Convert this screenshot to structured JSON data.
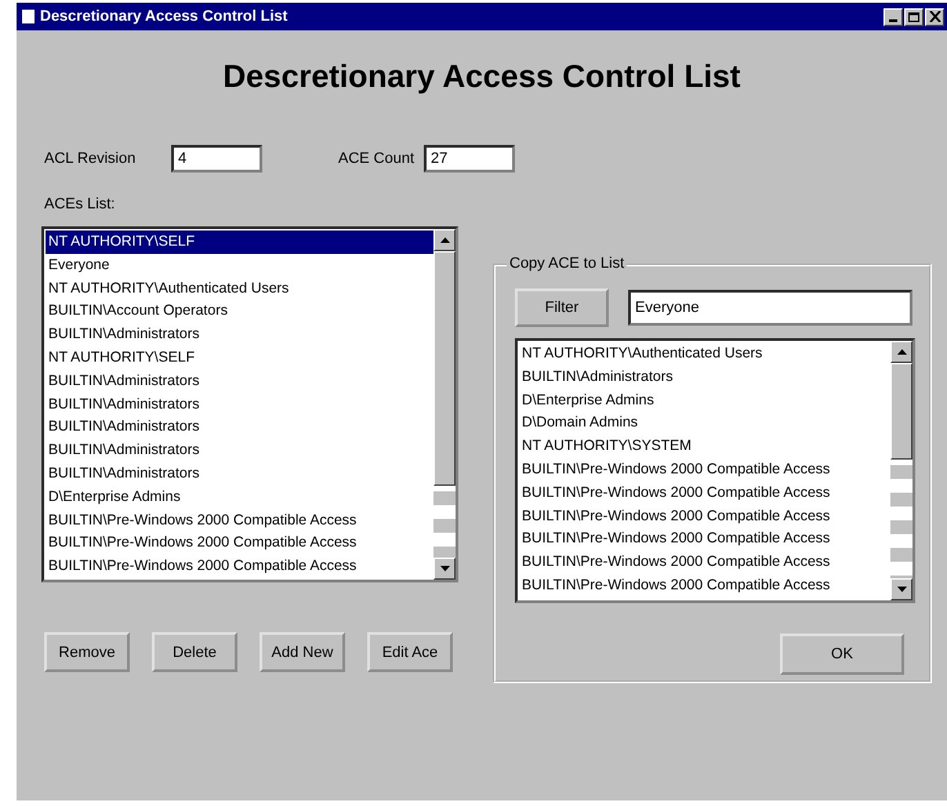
{
  "window": {
    "title": "Descretionary Access Control List"
  },
  "heading": "Descretionary Access Control List",
  "acl_revision": {
    "label": "ACL Revision",
    "value": "4"
  },
  "ace_count": {
    "label": "ACE Count",
    "value": "27"
  },
  "aces_list": {
    "label": "ACEs List:",
    "items": [
      {
        "text": "NT AUTHORITY\\SELF",
        "selected": true
      },
      {
        "text": "Everyone",
        "selected": false
      },
      {
        "text": "NT AUTHORITY\\Authenticated Users",
        "selected": false
      },
      {
        "text": "BUILTIN\\Account Operators",
        "selected": false
      },
      {
        "text": "BUILTIN\\Administrators",
        "selected": false
      },
      {
        "text": "NT AUTHORITY\\SELF",
        "selected": false
      },
      {
        "text": "BUILTIN\\Administrators",
        "selected": false
      },
      {
        "text": "BUILTIN\\Administrators",
        "selected": false
      },
      {
        "text": "BUILTIN\\Administrators",
        "selected": false
      },
      {
        "text": "BUILTIN\\Administrators",
        "selected": false
      },
      {
        "text": "BUILTIN\\Administrators",
        "selected": false
      },
      {
        "text": "D\\Enterprise Admins",
        "selected": false
      },
      {
        "text": "BUILTIN\\Pre-Windows 2000 Compatible Access",
        "selected": false
      },
      {
        "text": "BUILTIN\\Pre-Windows 2000 Compatible Access",
        "selected": false
      },
      {
        "text": "BUILTIN\\Pre-Windows 2000 Compatible Access",
        "selected": false
      }
    ]
  },
  "buttons": [
    "Remove",
    "Delete",
    "Add New",
    "Edit Ace"
  ],
  "copy_group": {
    "label": "Copy ACE to List",
    "filter_button": "Filter",
    "filter_value": "Everyone",
    "items": [
      "NT AUTHORITY\\Authenticated Users",
      "BUILTIN\\Administrators",
      "D\\Enterprise Admins",
      "D\\Domain Admins",
      "NT AUTHORITY\\SYSTEM",
      "BUILTIN\\Pre-Windows 2000 Compatible Access",
      "BUILTIN\\Pre-Windows 2000 Compatible Access",
      "BUILTIN\\Pre-Windows 2000 Compatible Access",
      "BUILTIN\\Pre-Windows 2000 Compatible Access",
      "BUILTIN\\Pre-Windows 2000 Compatible Access",
      "BUILTIN\\Pre-Windows 2000 Compatible Access"
    ],
    "ok_button": "OK"
  }
}
